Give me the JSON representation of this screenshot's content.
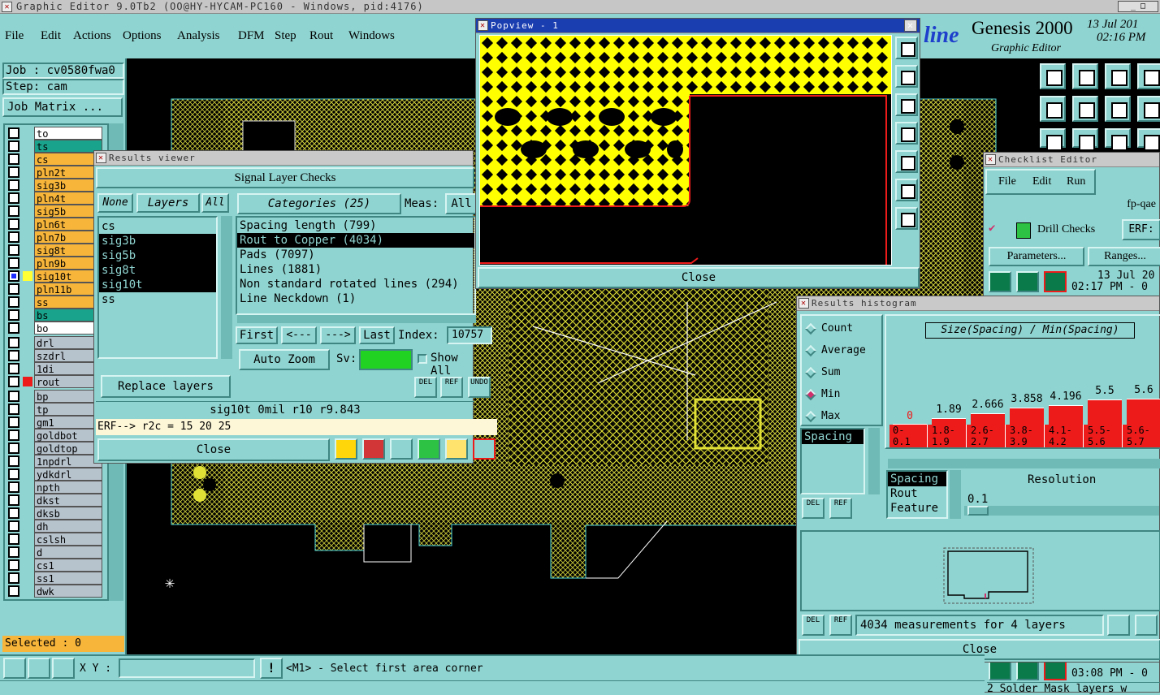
{
  "app": {
    "title": "Graphic Editor 9.0Tb2 (OO@HY-HYCAM-PC160 - Windows, pid:4176)",
    "menu": [
      "File",
      "Edit",
      "Actions",
      "Options",
      "Analysis",
      "DFM",
      "Step",
      "Rout",
      "Windows"
    ],
    "brand": "line",
    "brand_title": "Genesis 2000",
    "brand_sub": "Graphic Editor",
    "date": "13 Jul 201",
    "time": "02:16 PM"
  },
  "job_panel": {
    "job": "Job : cv0580fwa0",
    "step": "Step: cam",
    "matrix_btn": "Job Matrix ...",
    "selected": "Selected : 0"
  },
  "layers": [
    {
      "name": "to",
      "color": "#ffffff",
      "fill": "#ffffff"
    },
    {
      "name": "ts",
      "color": "#ffffff",
      "fill": "#1aa38c"
    },
    {
      "name": "cs",
      "color": "#ffffff",
      "fill": "#f7b53a"
    },
    {
      "name": "pln2t",
      "color": "#ffffff",
      "fill": "#f7b53a"
    },
    {
      "name": "sig3b",
      "color": "#ffffff",
      "fill": "#f7b53a"
    },
    {
      "name": "pln4t",
      "color": "#ffffff",
      "fill": "#f7b53a"
    },
    {
      "name": "sig5b",
      "color": "#ffffff",
      "fill": "#f7b53a"
    },
    {
      "name": "pln6t",
      "color": "#ffffff",
      "fill": "#f7b53a"
    },
    {
      "name": "pln7b",
      "color": "#ffffff",
      "fill": "#f7b53a"
    },
    {
      "name": "sig8t",
      "color": "#ffffff",
      "fill": "#f7b53a"
    },
    {
      "name": "pln9b",
      "color": "#ffffff",
      "fill": "#f7b53a"
    },
    {
      "name": "sig10t",
      "color": "#ffff33",
      "fill": "#f7b53a"
    },
    {
      "name": "pln11b",
      "color": "#ffffff",
      "fill": "#f7b53a"
    },
    {
      "name": "ss",
      "color": "#ffffff",
      "fill": "#f7b53a"
    },
    {
      "name": "bs",
      "color": "#ffffff",
      "fill": "#1aa38c"
    },
    {
      "name": "bo",
      "color": "#ffffff",
      "fill": "#ffffff"
    },
    {
      "name": "drl",
      "color": "#ffffff",
      "fill": "#b6c2cc"
    },
    {
      "name": "szdrl",
      "color": "#ffffff",
      "fill": "#b6c2cc"
    },
    {
      "name": "1di",
      "color": "#ffffff",
      "fill": "#b6c2cc"
    },
    {
      "name": "rout",
      "color": "#ee1b1b",
      "fill": "#b6c2cc"
    },
    {
      "name": "bp",
      "color": "#ffffff",
      "fill": "#b6c2cc"
    },
    {
      "name": "tp",
      "color": "#ffffff",
      "fill": "#b6c2cc"
    },
    {
      "name": "gm1",
      "color": "#ffffff",
      "fill": "#b6c2cc"
    },
    {
      "name": "goldbot",
      "color": "#ffffff",
      "fill": "#b6c2cc"
    },
    {
      "name": "goldtop",
      "color": "#ffffff",
      "fill": "#b6c2cc"
    },
    {
      "name": "1npdrl",
      "color": "#ffffff",
      "fill": "#b6c2cc"
    },
    {
      "name": "ydkdrl",
      "color": "#ffffff",
      "fill": "#b6c2cc"
    },
    {
      "name": "npth",
      "color": "#ffffff",
      "fill": "#b6c2cc"
    },
    {
      "name": "dkst",
      "color": "#ffffff",
      "fill": "#b6c2cc"
    },
    {
      "name": "dksb",
      "color": "#ffffff",
      "fill": "#b6c2cc"
    },
    {
      "name": "dh",
      "color": "#ffffff",
      "fill": "#b6c2cc"
    },
    {
      "name": "cslsh",
      "color": "#ffffff",
      "fill": "#b6c2cc"
    },
    {
      "name": "d",
      "color": "#ffffff",
      "fill": "#b6c2cc"
    },
    {
      "name": "cs1",
      "color": "#ffffff",
      "fill": "#b6c2cc"
    },
    {
      "name": "ss1",
      "color": "#ffffff",
      "fill": "#b6c2cc"
    },
    {
      "name": "dwk",
      "color": "#ffffff",
      "fill": "#b6c2cc"
    }
  ],
  "results_viewer": {
    "title": "Results viewer",
    "header": "Signal Layer Checks",
    "none_btn": "None",
    "layers_btn": "Layers",
    "all_btn": "All",
    "categories_btn": "Categories (25)",
    "meas_label": "Meas:",
    "meas_value": "All",
    "layer_list": [
      "cs",
      "sig3b",
      "sig5b",
      "sig8t",
      "sig10t",
      "ss"
    ],
    "categories": [
      "Spacing length (799)",
      "Rout to Copper (4034)",
      "Pads (7097)",
      "Lines (1881)",
      "Non standard rotated lines (294)",
      "Line Neckdown (1)"
    ],
    "first": "First",
    "prev": "<---",
    "next": "--->",
    "last": "Last",
    "index_label": "Index:",
    "index_value": "10757",
    "auto_zoom": "Auto Zoom",
    "sv_label": "Sv:",
    "show_all": "Show All",
    "del": "DEL",
    "ref": "REF",
    "undo": "UNDO",
    "replace_layers": "Replace layers",
    "status": "sig10t 0mil  r10  r9.843",
    "erf": "ERF--> r2c = 15 20 25",
    "close": "Close"
  },
  "popview": {
    "title": "Popview - 1",
    "close": "Close"
  },
  "checklist": {
    "title": "Checklist Editor",
    "menu": [
      "File",
      "Edit",
      "Run"
    ],
    "name": "fp-qae",
    "check": "Drill Checks",
    "erf": "ERF:",
    "params": "Parameters...",
    "ranges": "Ranges...",
    "date1": "13 Jul 20",
    "time1": "02:17 PM - 0",
    "time2": "03:08 PM - 0",
    "bottom": "2 Solder Mask layers w"
  },
  "histogram": {
    "title": "Results histogram",
    "modes": [
      "Count",
      "Average",
      "Sum",
      "Min",
      "Max"
    ],
    "selected_mode": "Min",
    "axis_title": "Size(Spacing) / Min(Spacing)",
    "values": [
      "0",
      "1.89",
      "2.666",
      "3.858",
      "4.196",
      "5.5",
      "5.6"
    ],
    "bars": [
      0,
      0.12,
      0.2,
      0.3,
      0.34,
      0.44,
      0.46
    ],
    "bins": [
      [
        "0-",
        "0.1"
      ],
      [
        "1.8-",
        "1.9"
      ],
      [
        "2.6-",
        "2.7"
      ],
      [
        "3.8-",
        "3.9"
      ],
      [
        "4.1-",
        "4.2"
      ],
      [
        "5.5-",
        "5.6"
      ],
      [
        "5.6-",
        "5.7"
      ]
    ],
    "meas_list": [
      "Spacing"
    ],
    "sort_list": [
      "Spacing",
      "Rout",
      "Feature"
    ],
    "resolution_label": "Resolution",
    "resolution_value": "0.1",
    "measurements": "4034 measurements for 4 layers",
    "close": "Close",
    "del": "DEL",
    "ref": "REF",
    "colors": {
      "bar": "#ee1b1b"
    }
  },
  "statusbar": {
    "xy_label": "X Y :",
    "xy_value": "",
    "warn": "!",
    "message": "<M1> - Select first area corner"
  }
}
